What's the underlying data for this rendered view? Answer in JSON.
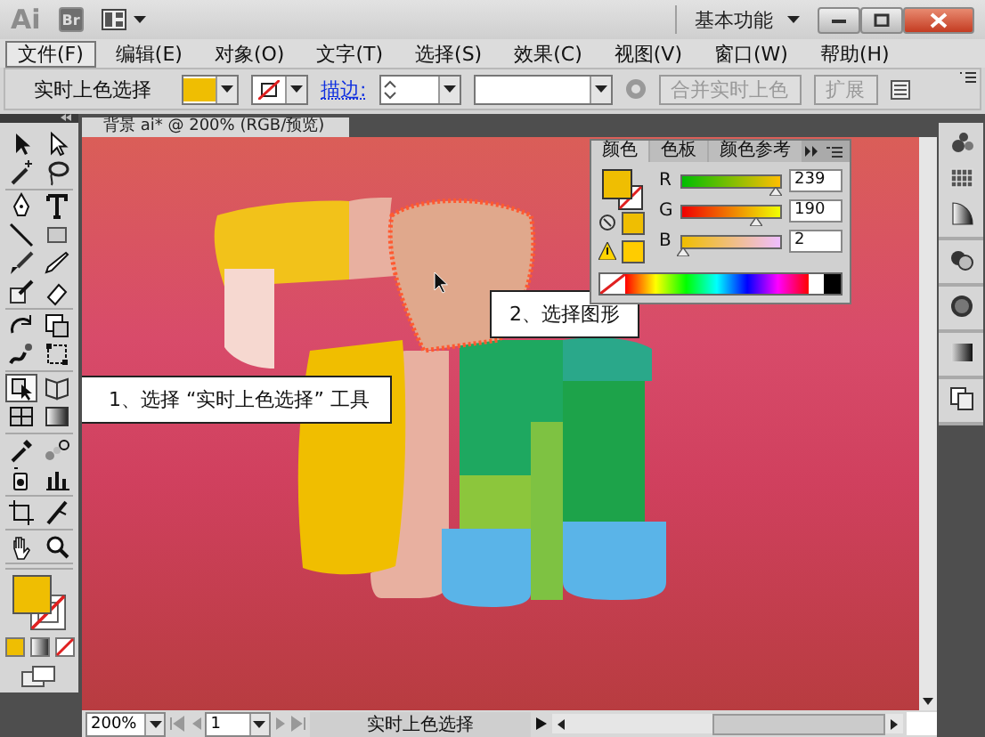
{
  "app": {
    "logo": "Ai",
    "bridge_button": "Br",
    "workspace": "基本功能"
  },
  "menu": [
    {
      "label": "文件(F)",
      "selected": true
    },
    {
      "label": "编辑(E)",
      "selected": false
    },
    {
      "label": "对象(O)",
      "selected": false
    },
    {
      "label": "文字(T)",
      "selected": false
    },
    {
      "label": "选择(S)",
      "selected": false
    },
    {
      "label": "效果(C)",
      "selected": false
    },
    {
      "label": "视图(V)",
      "selected": false
    },
    {
      "label": "窗口(W)",
      "selected": false
    },
    {
      "label": "帮助(H)",
      "selected": false
    }
  ],
  "control_bar": {
    "tool_name": "实时上色选择",
    "stroke_label": "描边:",
    "buttons": [
      {
        "label": "合并实时上色",
        "disabled": true
      },
      {
        "label": "扩展",
        "disabled": true
      }
    ]
  },
  "tools": [
    {
      "kind": "select",
      "selected": false
    },
    {
      "kind": "direct",
      "selected": false
    },
    {
      "kind": "wand",
      "selected": false
    },
    {
      "kind": "lasso",
      "selected": false
    },
    {
      "kind": "pen",
      "selected": false
    },
    {
      "kind": "type",
      "selected": false
    },
    {
      "kind": "line",
      "selected": false
    },
    {
      "kind": "rect",
      "selected": false
    },
    {
      "kind": "brush",
      "selected": false
    },
    {
      "kind": "pencil",
      "selected": false
    },
    {
      "kind": "blob",
      "selected": false
    },
    {
      "kind": "eraser",
      "selected": false
    },
    {
      "kind": "rotate",
      "selected": false
    },
    {
      "kind": "scale",
      "selected": false
    },
    {
      "kind": "warp",
      "selected": false
    },
    {
      "kind": "transform",
      "selected": false
    },
    {
      "kind": "livepaint",
      "selected": true
    },
    {
      "kind": "grid",
      "selected": false
    },
    {
      "kind": "mesh",
      "selected": false
    },
    {
      "kind": "gradient",
      "selected": false
    },
    {
      "kind": "eyedropper",
      "selected": false
    },
    {
      "kind": "blend",
      "selected": false
    },
    {
      "kind": "spray",
      "selected": false
    },
    {
      "kind": "graph",
      "selected": false
    },
    {
      "kind": "artboard",
      "selected": false
    },
    {
      "kind": "slice",
      "selected": false
    },
    {
      "kind": "hand",
      "selected": false
    },
    {
      "kind": "zoom",
      "selected": false
    }
  ],
  "document": {
    "tab": "背景 ai* @ 200% (RGB/预览)"
  },
  "color_panel": {
    "tabs": [
      {
        "label": "颜色",
        "selected": true
      },
      {
        "label": "色板",
        "selected": false
      },
      {
        "label": "颜色参考",
        "selected": false
      }
    ],
    "channels": [
      {
        "name": "R",
        "value": "239",
        "level": 0.937
      },
      {
        "name": "G",
        "value": "190",
        "level": 0.745
      },
      {
        "name": "B",
        "value": "2",
        "level": 0.008
      }
    ]
  },
  "callouts": [
    {
      "text": "2、选择图形"
    },
    {
      "text": "1、选择 “实时上色选择” 工具"
    }
  ],
  "status_bar": {
    "zoom": "200%",
    "page": "1",
    "status": "实时上色选择"
  }
}
